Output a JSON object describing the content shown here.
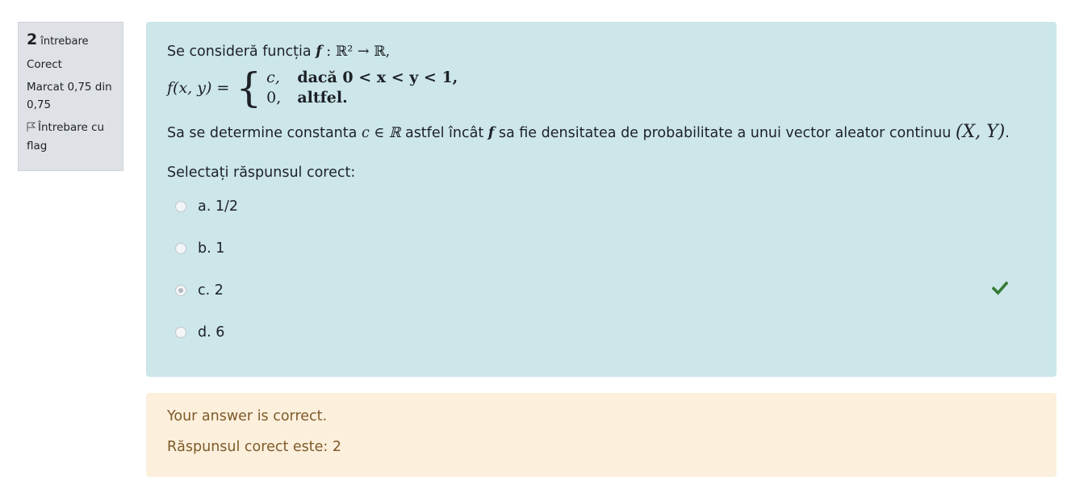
{
  "info": {
    "question_number": "2",
    "question_label": "întrebare",
    "state": "Corect",
    "grade": "Marcat 0,75 din 0,75",
    "flag_label": "Întrebare cu flag"
  },
  "question": {
    "line1_text": "Se consideră funcția",
    "line1_math_f": "f",
    "line1_math_rest": ": ℝ² → ℝ,",
    "fx_lhs": "f(x, y) =",
    "case1_value": "c,",
    "case1_condition": "dacă 0 < x < y < 1,",
    "case2_value": "0,",
    "case2_condition": "altfel.",
    "line2_prefix": "Sa se determine constanta",
    "line2_math_c": "c ∈ ℝ",
    "line2_middle": "astfel încât",
    "line2_math_f": "f",
    "line2_suffix": "sa fie densitatea de probabilitate a unui vector aleator continuu",
    "line2_math_xy": "(X, Y)",
    "line2_end": "."
  },
  "prompt": "Selectați răspunsul corect:",
  "answers": [
    {
      "label": "a. 1/2",
      "selected": false
    },
    {
      "label": "b. 1",
      "selected": false
    },
    {
      "label": "c. 2",
      "selected": true
    },
    {
      "label": "d. 6",
      "selected": false
    }
  ],
  "correct_icon": "check-icon",
  "feedback": {
    "status": "Your answer is correct.",
    "right_answer": "Răspunsul corect este: 2"
  },
  "colors": {
    "question_bg": "#cce6ea",
    "feedback_bg": "#fcefdc",
    "info_bg": "#dee2e6",
    "check": "#357a32"
  }
}
